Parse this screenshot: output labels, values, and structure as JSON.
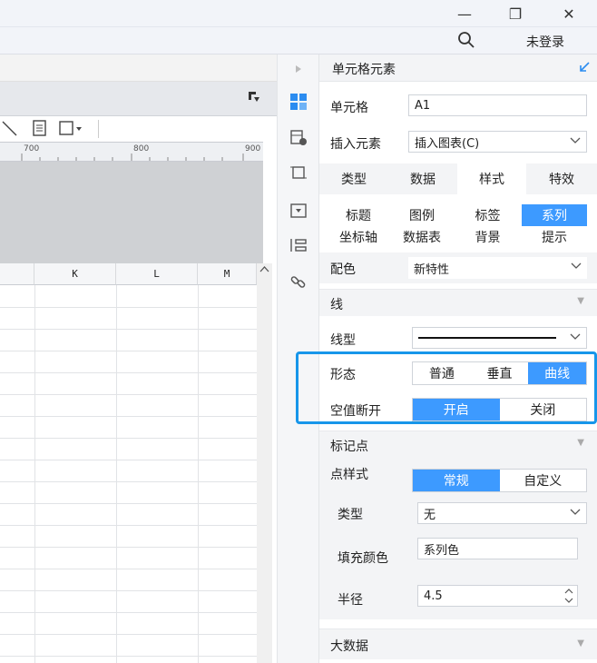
{
  "window": {
    "minimize_glyph": "—",
    "restore_glyph": "❐",
    "close_glyph": "✕",
    "login_label": "未登录"
  },
  "ruler": {
    "ticks": [
      "700",
      "800",
      "900"
    ]
  },
  "sheet": {
    "columns": [
      "K",
      "L",
      "M"
    ]
  },
  "panel": {
    "title": "单元格元素",
    "cell_label": "单元格",
    "cell_value": "A1",
    "insert_label": "插入元素",
    "insert_value": "插入图表(C)",
    "main_tabs": [
      "类型",
      "数据",
      "样式",
      "特效"
    ],
    "active_main_tab": "样式",
    "sub_tabs_row1": [
      "标题",
      "图例",
      "标签",
      "系列"
    ],
    "sub_tabs_row2": [
      "坐标轴",
      "数据表",
      "背景",
      "提示"
    ],
    "active_sub_tab": "系列",
    "color_label": "配色",
    "color_value": "新特性",
    "line_section": "线",
    "line_type_label": "线型",
    "shape_label": "形态",
    "shape_options": [
      "普通",
      "垂直",
      "曲线"
    ],
    "shape_selected": "曲线",
    "null_break_label": "空值断开",
    "null_break_options": [
      "开启",
      "关闭"
    ],
    "null_break_selected": "开启",
    "marker_section": "标记点",
    "point_style_label": "点样式",
    "point_style_options": [
      "常规",
      "自定义"
    ],
    "point_style_selected": "常规",
    "type_label": "类型",
    "type_value": "无",
    "fill_label": "填充颜色",
    "fill_value": "系列色",
    "radius_label": "半径",
    "radius_value": "4.5",
    "bigdata_section": "大数据"
  },
  "colors": {
    "accent": "#3d9aff",
    "highlight_border": "#1796ea"
  }
}
